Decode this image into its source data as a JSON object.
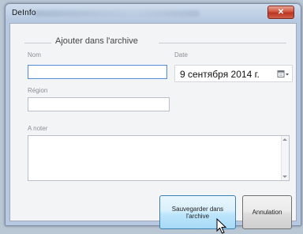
{
  "window": {
    "title": "DeInfo",
    "close_label": "✕"
  },
  "form": {
    "group_title": "Ajouter dans l'archive",
    "name_label": "Nom",
    "name_value": "",
    "date_label": "Date",
    "date_value": "9 сентября 2014 г.",
    "region_label": "Région",
    "region_value": "",
    "note_label": "A noter",
    "note_value": ""
  },
  "buttons": {
    "save_line1": "Sauvegarder dans",
    "save_line2": "l'archive",
    "cancel_label": "Annulation"
  },
  "icons": {
    "calendar": "calendar-dropdown-icon",
    "cursor": "mouse-pointer-icon"
  },
  "colors": {
    "accent": "#3c7fb1",
    "close": "#c8452f"
  }
}
